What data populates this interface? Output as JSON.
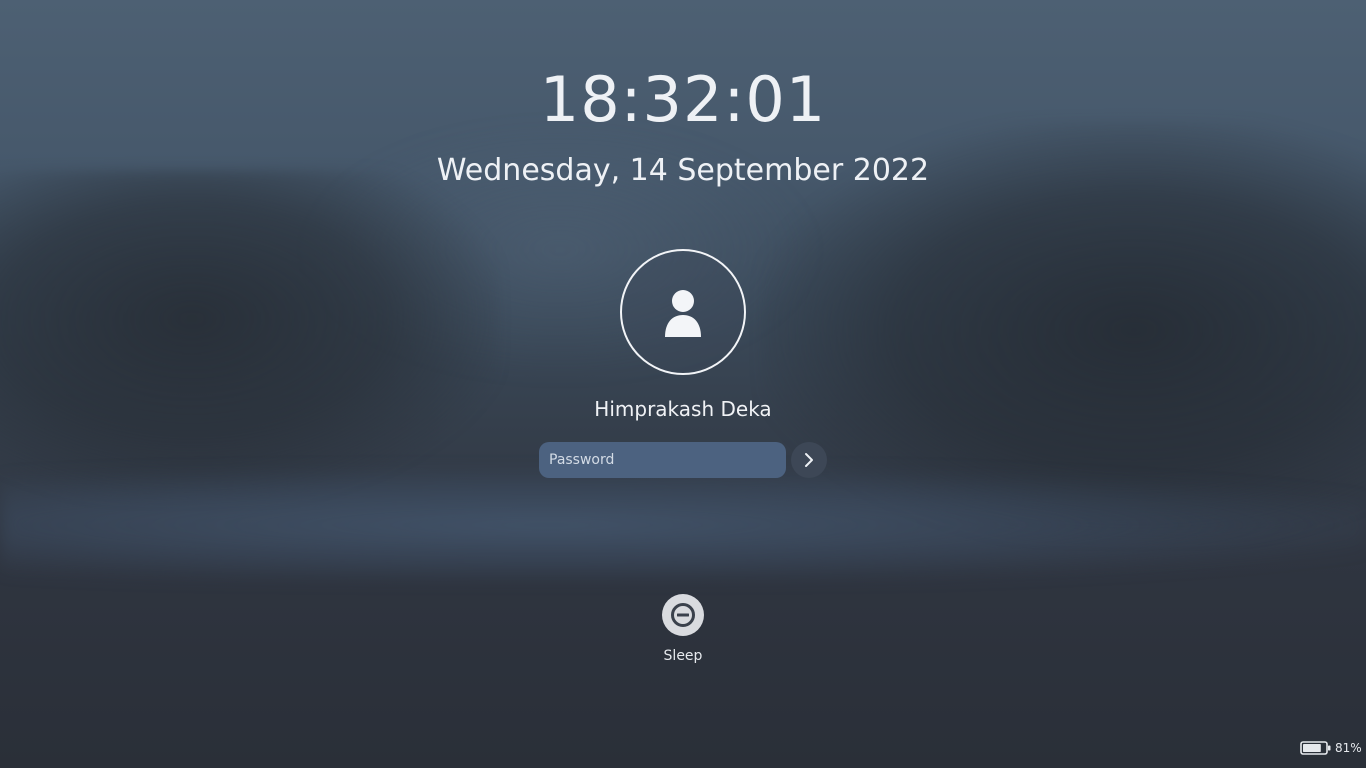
{
  "lockscreen": {
    "time": "18:32:01",
    "date": "Wednesday, 14 September 2022",
    "user": {
      "name": "Himprakash Deka",
      "avatar_icon": "user-icon"
    },
    "password": {
      "placeholder": "Password",
      "value": "",
      "submit_icon": "chevron-right-icon"
    },
    "actions": [
      {
        "label": "Sleep",
        "icon": "sleep-icon"
      }
    ]
  },
  "status": {
    "battery_percent_label": "81%",
    "battery_level": 0.81,
    "battery_icon": "battery-icon"
  },
  "colors": {
    "text": "#eef1f5",
    "input_background": "#4c6280",
    "submit_background": "#3d4756",
    "sleep_button_background": "#d9dbdf"
  }
}
